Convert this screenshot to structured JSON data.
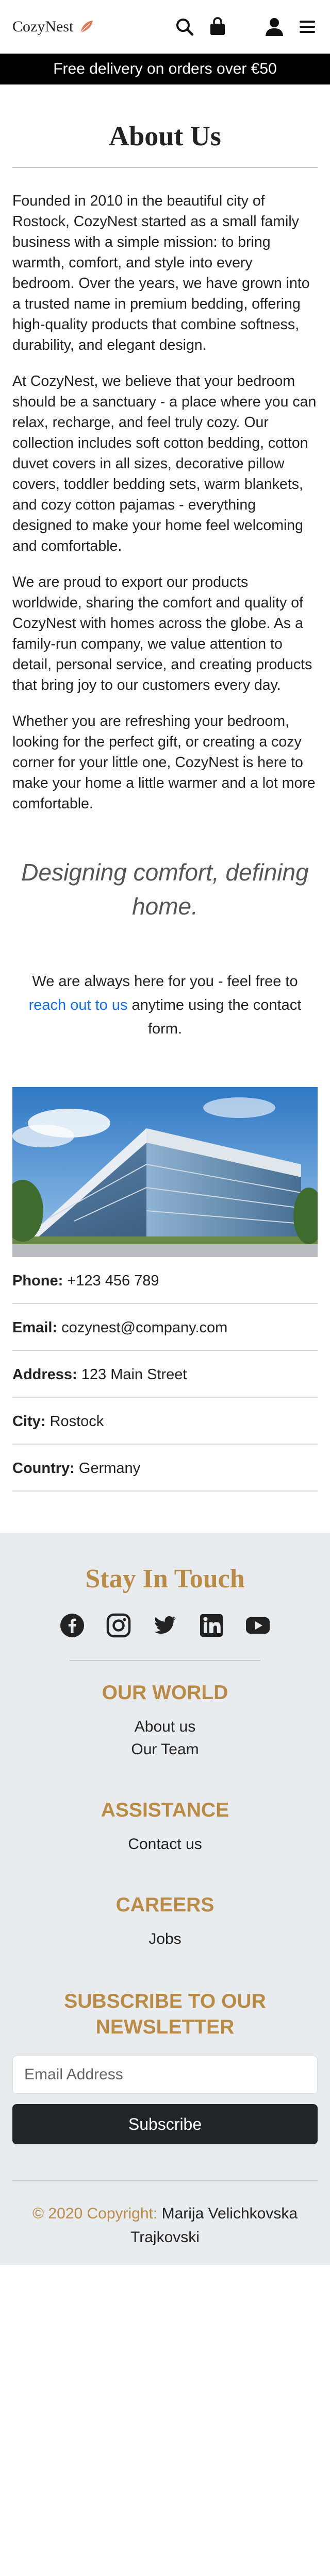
{
  "header": {
    "brand": "CozyNest",
    "icons": [
      "search-icon",
      "shopping-bag-icon",
      "user-icon",
      "menu-icon"
    ]
  },
  "promo": "Free delivery on orders over €50",
  "page_title": "About Us",
  "paragraphs": [
    "Founded in 2010 in the beautiful city of Rostock, CozyNest started as a small family business with a simple mission: to bring warmth, comfort, and style into every bedroom. Over the years, we have grown into a trusted name in premium bedding, offering high-quality products that combine softness, durability, and elegant design.",
    "At CozyNest, we believe that your bedroom should be a sanctuary - a place where you can relax, recharge, and feel truly cozy. Our collection includes soft cotton bedding, cotton duvet covers in all sizes, decorative pillow covers, toddler bedding sets, warm blankets, and cozy cotton pajamas - everything designed to make your home feel welcoming and comfortable.",
    "We are proud to export our products worldwide, sharing the comfort and quality of CozyNest with homes across the globe. As a family-run company, we value attention to detail, personal service, and creating products that bring joy to our customers every day.",
    "Whether you are refreshing your bedroom, looking for the perfect gift, or creating a cozy corner for your little one, CozyNest is here to make your home a little warmer and a lot more comfortable."
  ],
  "quote": "Designing comfort, defining home.",
  "contact_text": {
    "before": "We are always here for you - feel free to ",
    "link": "reach out to us",
    "after": " anytime using the contact form."
  },
  "info": [
    {
      "label": "Phone:",
      "value": "+123 456 789"
    },
    {
      "label": "Email:",
      "value": "cozynest@company.com"
    },
    {
      "label": "Address:",
      "value": "123 Main Street"
    },
    {
      "label": "City:",
      "value": "Rostock"
    },
    {
      "label": "Country:",
      "value": "Germany"
    }
  ],
  "footer": {
    "stay_title": "Stay In Touch",
    "social_icons": [
      "facebook-icon",
      "instagram-icon",
      "twitter-icon",
      "linkedin-icon",
      "youtube-icon"
    ],
    "sections": [
      {
        "heading": "OUR WORLD",
        "links": [
          "About us",
          "Our Team"
        ]
      },
      {
        "heading": "ASSISTANCE",
        "links": [
          "Contact us"
        ]
      },
      {
        "heading": "CAREERS",
        "links": [
          "Jobs"
        ]
      }
    ],
    "newsletter_heading": "SUBSCRIBE TO OUR NEWSLETTER",
    "email_placeholder": "Email Address",
    "subscribe_label": "Subscribe",
    "copyright_prefix": "© 2020 Copyright:",
    "copyright_name": "Marija Velichkovska Trajkovski"
  },
  "colors": {
    "accent_gold": "#b98b45",
    "link_blue": "#0d6efd",
    "promo_bg": "#000000",
    "footer_bg": "#e9ecef",
    "button_dark": "#212529"
  }
}
